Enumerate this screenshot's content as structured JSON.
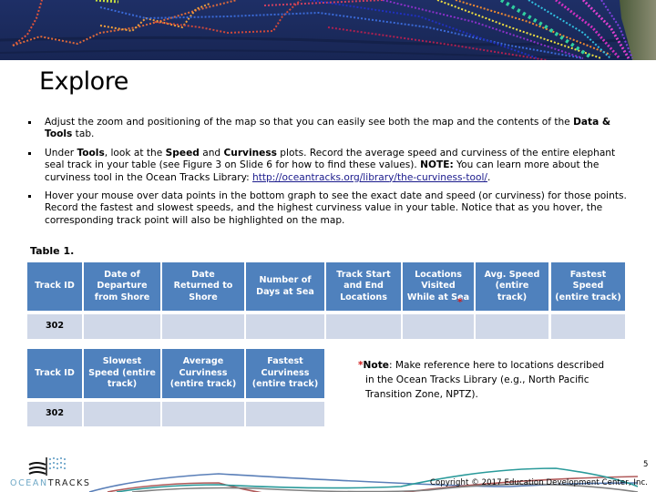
{
  "slide": {
    "title": "Explore",
    "page_number": "5",
    "copyright": "Copyright © 2017 Education Development Center, Inc."
  },
  "banner": {
    "icon": "ocean-map-with-tracks"
  },
  "bullets": [
    {
      "parts": [
        {
          "text": "Adjust the zoom and positioning of the map so that you can easily see both the map and the contents of the ",
          "bold": false
        },
        {
          "text": "Data & Tools",
          "bold": true
        },
        {
          "text": " tab.",
          "bold": false
        }
      ]
    },
    {
      "parts": [
        {
          "text": "Under ",
          "bold": false
        },
        {
          "text": "Tools",
          "bold": true
        },
        {
          "text": ", look at the ",
          "bold": false
        },
        {
          "text": "Speed",
          "bold": true
        },
        {
          "text": " and ",
          "bold": false
        },
        {
          "text": "Curviness",
          "bold": true
        },
        {
          "text": " plots. Record the average speed and curviness of the entire elephant seal track in your table (see Figure 3 on Slide 6 for how to find these values). ",
          "bold": false
        },
        {
          "text": "NOTE:",
          "bold": true
        },
        {
          "text": " You can learn more about the curviness tool in the Ocean Tracks Library: ",
          "bold": false
        },
        {
          "text": "http://oceantracks.org/library/the-curviness-tool/",
          "link": true
        },
        {
          "text": ".",
          "bold": false
        }
      ]
    },
    {
      "parts": [
        {
          "text": "Hover your mouse over data points in the bottom graph to see the exact date and speed (or curviness) for those points. Record the fastest and slowest speeds, and the highest curviness value in your table. Notice that as you hover, the corresponding track point will also be highlighted on the map.",
          "bold": false
        }
      ]
    }
  ],
  "table": {
    "caption": "Table 1.",
    "part1": {
      "headers": [
        "Track ID",
        "Date of Departure from Shore",
        "Date Returned to Shore",
        "Number of Days at Sea",
        "Track Start and End Locations",
        "Locations Visited While at Sea",
        "Avg. Speed (entire track)",
        "Fastest Speed (entire track)"
      ],
      "row": [
        "302",
        "",
        "",
        "",
        "",
        "",
        "",
        ""
      ]
    },
    "part2": {
      "headers": [
        "Track ID",
        "Slowest Speed (entire track)",
        "Average Curviness (entire track)",
        "Fastest Curviness (entire track)"
      ],
      "row": [
        "302",
        "",
        "",
        ""
      ]
    },
    "asterisk": "*"
  },
  "note": {
    "asterisk": "*",
    "label": "Note",
    "text_line1": ": Make reference here to locations described",
    "text_line2": "in the Ocean Tracks Library (e.g., North Pacific",
    "text_line3": "Transition Zone, NPTZ)."
  },
  "logo": {
    "part1": "OCEAN",
    "part2": "TRACKS"
  }
}
